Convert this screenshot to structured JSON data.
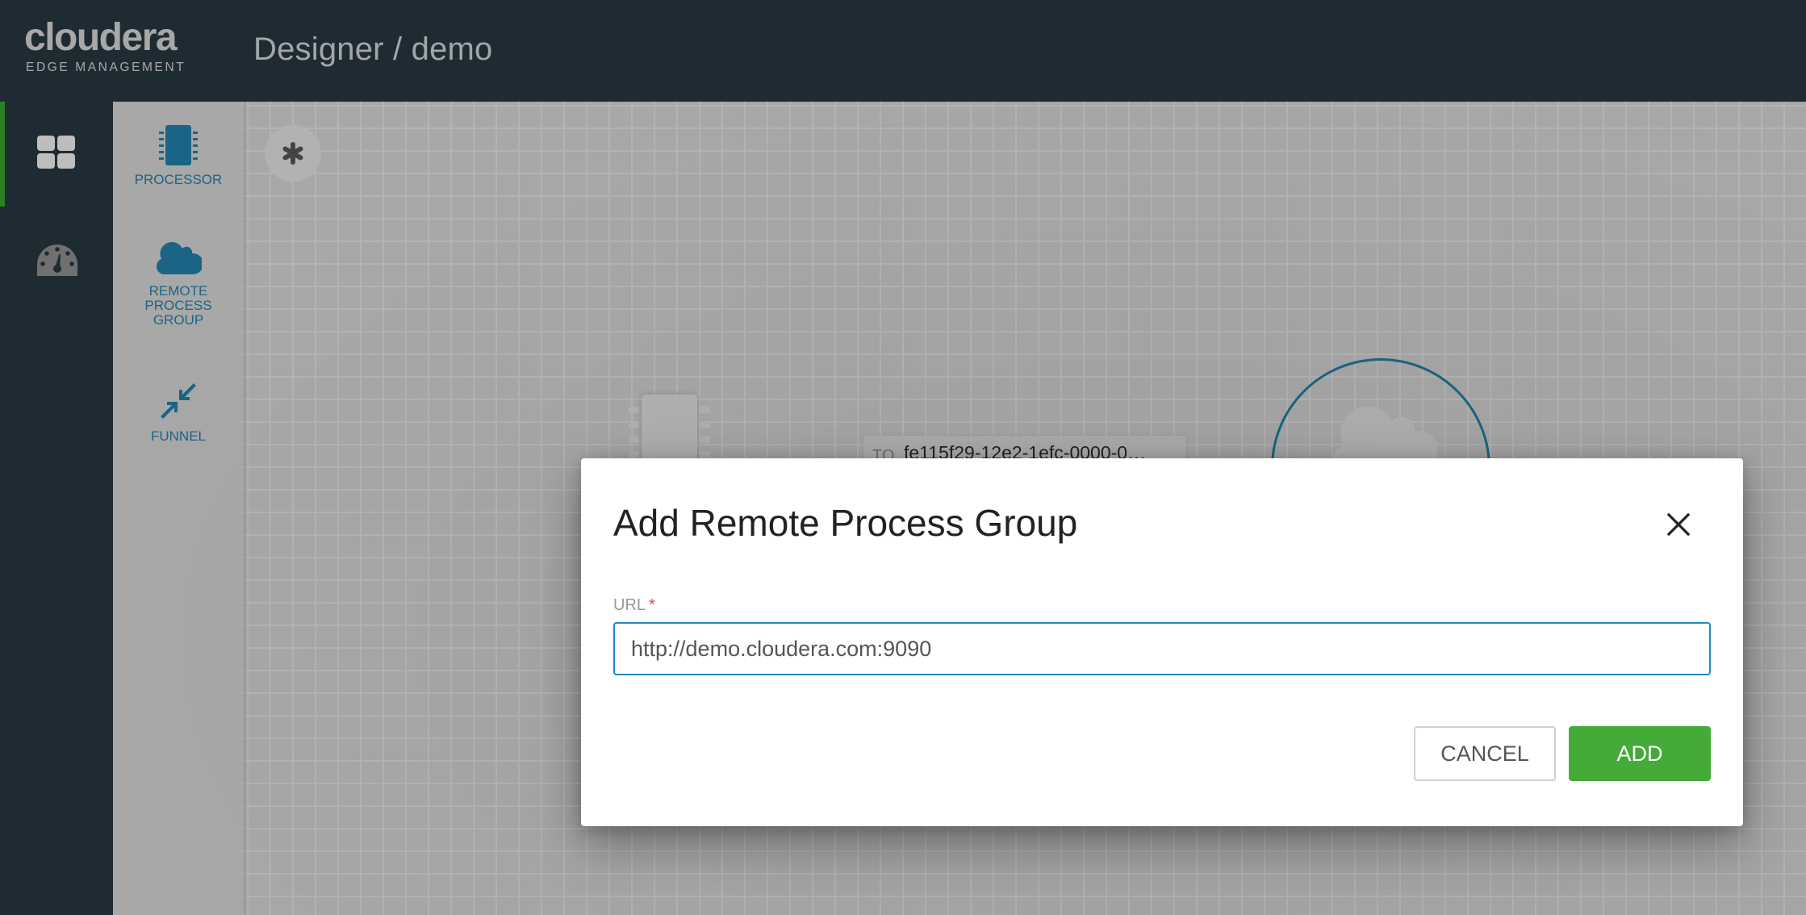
{
  "header": {
    "logo_main": "cloudera",
    "logo_sub": "EDGE MANAGEMENT",
    "title": "Designer / demo"
  },
  "leftnav": {
    "items": [
      {
        "name": "dashboard",
        "icon": "grid-icon",
        "active": true
      },
      {
        "name": "monitor",
        "icon": "gauge-icon",
        "active": false
      }
    ],
    "active_color": "#2f7f25"
  },
  "toolbox": {
    "items": [
      {
        "label": "PROCESSOR",
        "icon": "processor-chip-icon"
      },
      {
        "label": "REMOTE PROCESS GROUP",
        "label_lines": [
          "REMOTE",
          "PROCESS",
          "GROUP"
        ],
        "icon": "cloud-icon"
      },
      {
        "label": "FUNNEL",
        "icon": "funnel-arrows-icon"
      }
    ],
    "accent_color": "#1a6585"
  },
  "canvas": {
    "global_button_icon": "asterisk-icon",
    "connection": {
      "prefix": "TO",
      "target_id": "fe115f29-12e2-1efc-0000-0…"
    }
  },
  "dialog": {
    "title": "Add Remote Process Group",
    "close_icon": "close-icon",
    "url_field": {
      "label": "URL",
      "required_marker": "*",
      "value": "http://demo.cloudera.com:9090"
    },
    "cancel_label": "CANCEL",
    "add_label": "ADD",
    "colors": {
      "primary": "#44ab38",
      "focus_border": "#1f8ac0",
      "required": "#e0464a"
    }
  }
}
